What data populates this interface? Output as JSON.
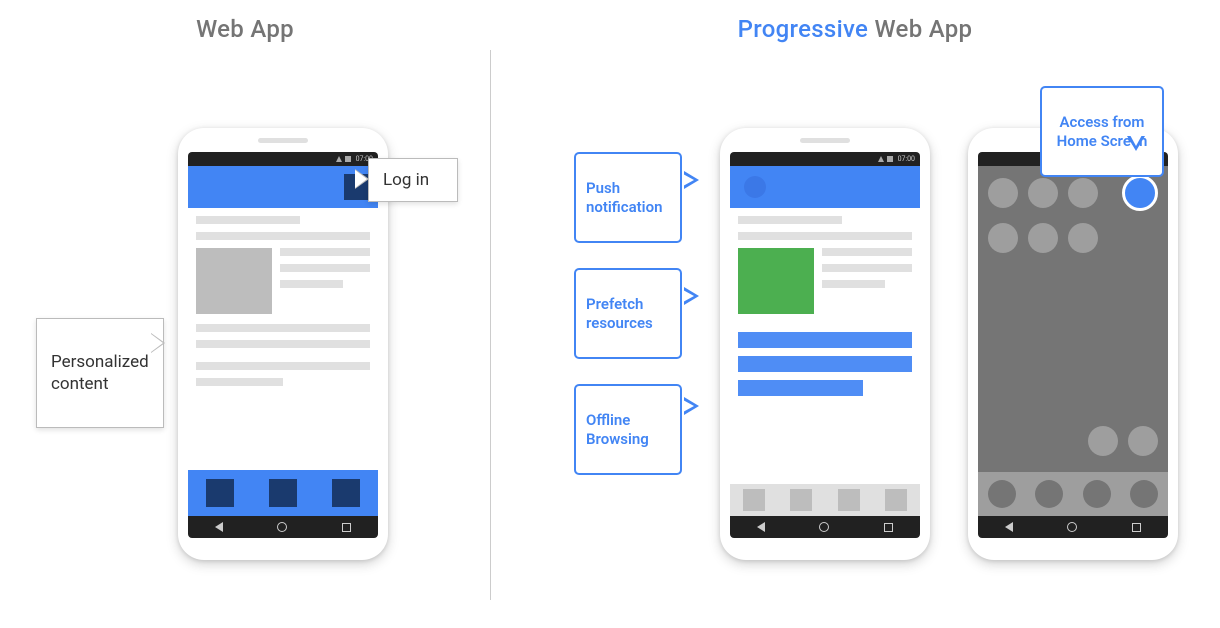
{
  "left": {
    "title": "Web App",
    "callouts": {
      "login": "Log in",
      "personalized": "Personalized\ncontent"
    }
  },
  "right": {
    "title_highlight": "Progressive",
    "title_rest": " Web App",
    "callouts": {
      "push": "Push\nnotification",
      "prefetch": "Prefetch\nresources",
      "offline": "Offline\nBrowsing",
      "homescreen": "Access from\nHome Screen"
    }
  },
  "statusbar": {
    "time": "07:00"
  }
}
